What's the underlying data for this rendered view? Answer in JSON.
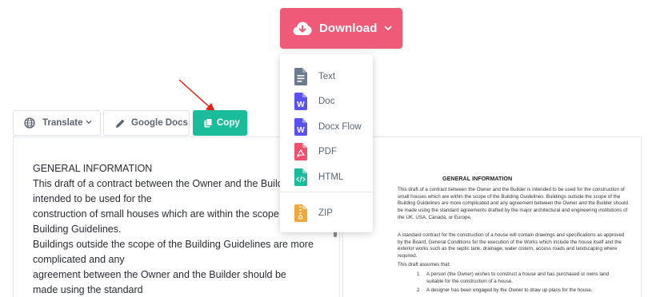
{
  "download": {
    "label": "Download"
  },
  "menu": {
    "items": [
      {
        "label": "Text",
        "icon": "text-file-icon",
        "color": "#6b7a90"
      },
      {
        "label": "Doc",
        "icon": "word-doc-icon",
        "color": "#5a52f0"
      },
      {
        "label": "Docx Flow",
        "icon": "word-docx-icon",
        "color": "#5a52f0"
      },
      {
        "label": "PDF",
        "icon": "pdf-icon",
        "color": "#f0506e"
      },
      {
        "label": "HTML",
        "icon": "html-file-icon",
        "color": "#1bbc9b"
      },
      {
        "label": "ZIP",
        "icon": "zip-file-icon",
        "color": "#f0a83c"
      }
    ]
  },
  "toolbar": {
    "translate_label": "Translate",
    "gdocs_label": "Google Docs",
    "copy_label": "Copy"
  },
  "editor": {
    "lines": [
      "GENERAL INFORMATION",
      "This draft of a contract between the Owner and the Builder is",
      "intended to be used for the",
      "construction of small houses which are within the scope of the",
      "Building Guidelines.",
      "Buildings outside the scope of the Building Guidelines are more",
      "complicated and any",
      "agreement between the Owner and the Builder should be",
      "made using the standard"
    ]
  },
  "preview": {
    "title": "GENERAL INFORMATION",
    "para1": "This draft of a contract between the Owner and the Builder is intended to be used for the construction of small houses which are within the scope of the Building Guidelines. Buildings outside the scope of the Building Guidelines are more complicated and any agreement between the Owner and the Builder should be made using the standard agreements drafted by the major architectural and engineering institutions of the UK, USA, Canada, or Europe.",
    "para2": "A standard contract for the construction of a house will contain drawings and specifications as approved by the Board, General Conditions for the execution of the Works which include the house itself and the exterior works such as the septic tank, drainage, water cistern, access roads and landscaping where required.",
    "para3": "This draft assumes that:",
    "list": [
      {
        "num": "1",
        "text": "A person (the Owner) wishes to construct a house and has purchased or owns land suitable for the construction of a house."
      },
      {
        "num": "2",
        "text": "A designer has been engaged by the Owner to draw up plans for the house."
      }
    ]
  },
  "colors": {
    "accent_download": "#ee5a78",
    "accent_copy": "#1bbc9b",
    "annotation_arrow": "#e8231a"
  }
}
